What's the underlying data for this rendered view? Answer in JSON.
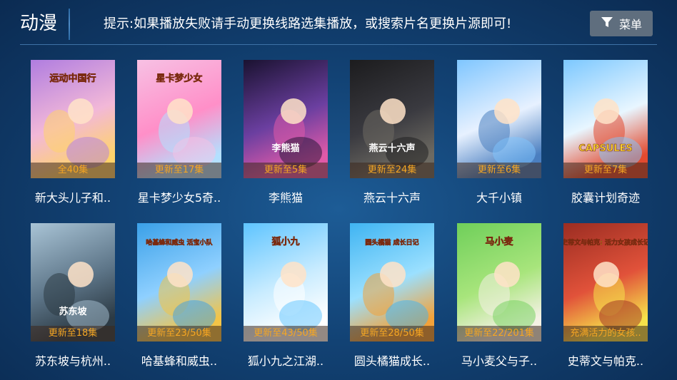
{
  "header": {
    "title": "动漫",
    "notice": "提示:如果播放失败请手动更换线路选集播放，或搜索片名更换片源即可!",
    "menu_label": "菜单",
    "menu_icon": "filter-icon"
  },
  "cards": [
    {
      "title": "新大头儿子和..",
      "badge": "全40集",
      "poster_text": "运动中国行",
      "colors": [
        "#b07de0",
        "#f2b8d8",
        "#ffd36b"
      ]
    },
    {
      "title": "星卡梦少女5奇..",
      "badge": "更新至17集",
      "poster_text": "星卡梦少女",
      "colors": [
        "#f7c1e4",
        "#ff8fc8",
        "#b3e0ff"
      ]
    },
    {
      "title": "李熊猫",
      "badge": "更新至5集",
      "poster_text": "李熊猫",
      "colors": [
        "#1a1230",
        "#6b3fa0",
        "#e05aa8"
      ]
    },
    {
      "title": "燕云十六声",
      "badge": "更新至24集",
      "poster_text": "燕云十六声",
      "colors": [
        "#1c1c1e",
        "#3a3a40",
        "#6d6a62"
      ]
    },
    {
      "title": "大千小镇",
      "badge": "更新至6集",
      "poster_text": "",
      "colors": [
        "#7fc6ff",
        "#e7f1ff",
        "#4b7fc0"
      ]
    },
    {
      "title": "胶囊计划奇迹",
      "badge": "更新至7集",
      "poster_text": "CAPSULES",
      "colors": [
        "#7cc8ff",
        "#e8f6ff",
        "#e24a2f"
      ]
    },
    {
      "title": "苏东坡与杭州..",
      "badge": "更新至18集",
      "poster_text": "苏东坡",
      "colors": [
        "#a9c4d6",
        "#5d7588",
        "#2c3a44"
      ]
    },
    {
      "title": "哈基蜂和威虫..",
      "badge": "更新至23/50集",
      "poster_text": "哈基蜂和威虫 活宝小队",
      "colors": [
        "#3aa0e8",
        "#8fd0ff",
        "#f3c447"
      ]
    },
    {
      "title": "狐小九之江湖..",
      "badge": "更新至43/50集",
      "poster_text": "狐小九",
      "colors": [
        "#5ec4ff",
        "#c9ecff",
        "#ffffff"
      ]
    },
    {
      "title": "圆头橘猫成长..",
      "badge": "更新至28/50集",
      "poster_text": "圆头橘猫 成长日记",
      "colors": [
        "#3fb4f2",
        "#9be0ff",
        "#f2a23a"
      ]
    },
    {
      "title": "马小麦父与子..",
      "badge": "更新至22/201集",
      "poster_text": "马小麦",
      "colors": [
        "#6fcf5a",
        "#a8e57c",
        "#f4f1e4"
      ]
    },
    {
      "title": "史蒂文与帕克..",
      "badge": "充满活力的女孩..",
      "poster_text": "史蒂文与帕克: 活力女孩成长记",
      "colors": [
        "#9b2d22",
        "#e1523a",
        "#f6e24a"
      ]
    }
  ]
}
